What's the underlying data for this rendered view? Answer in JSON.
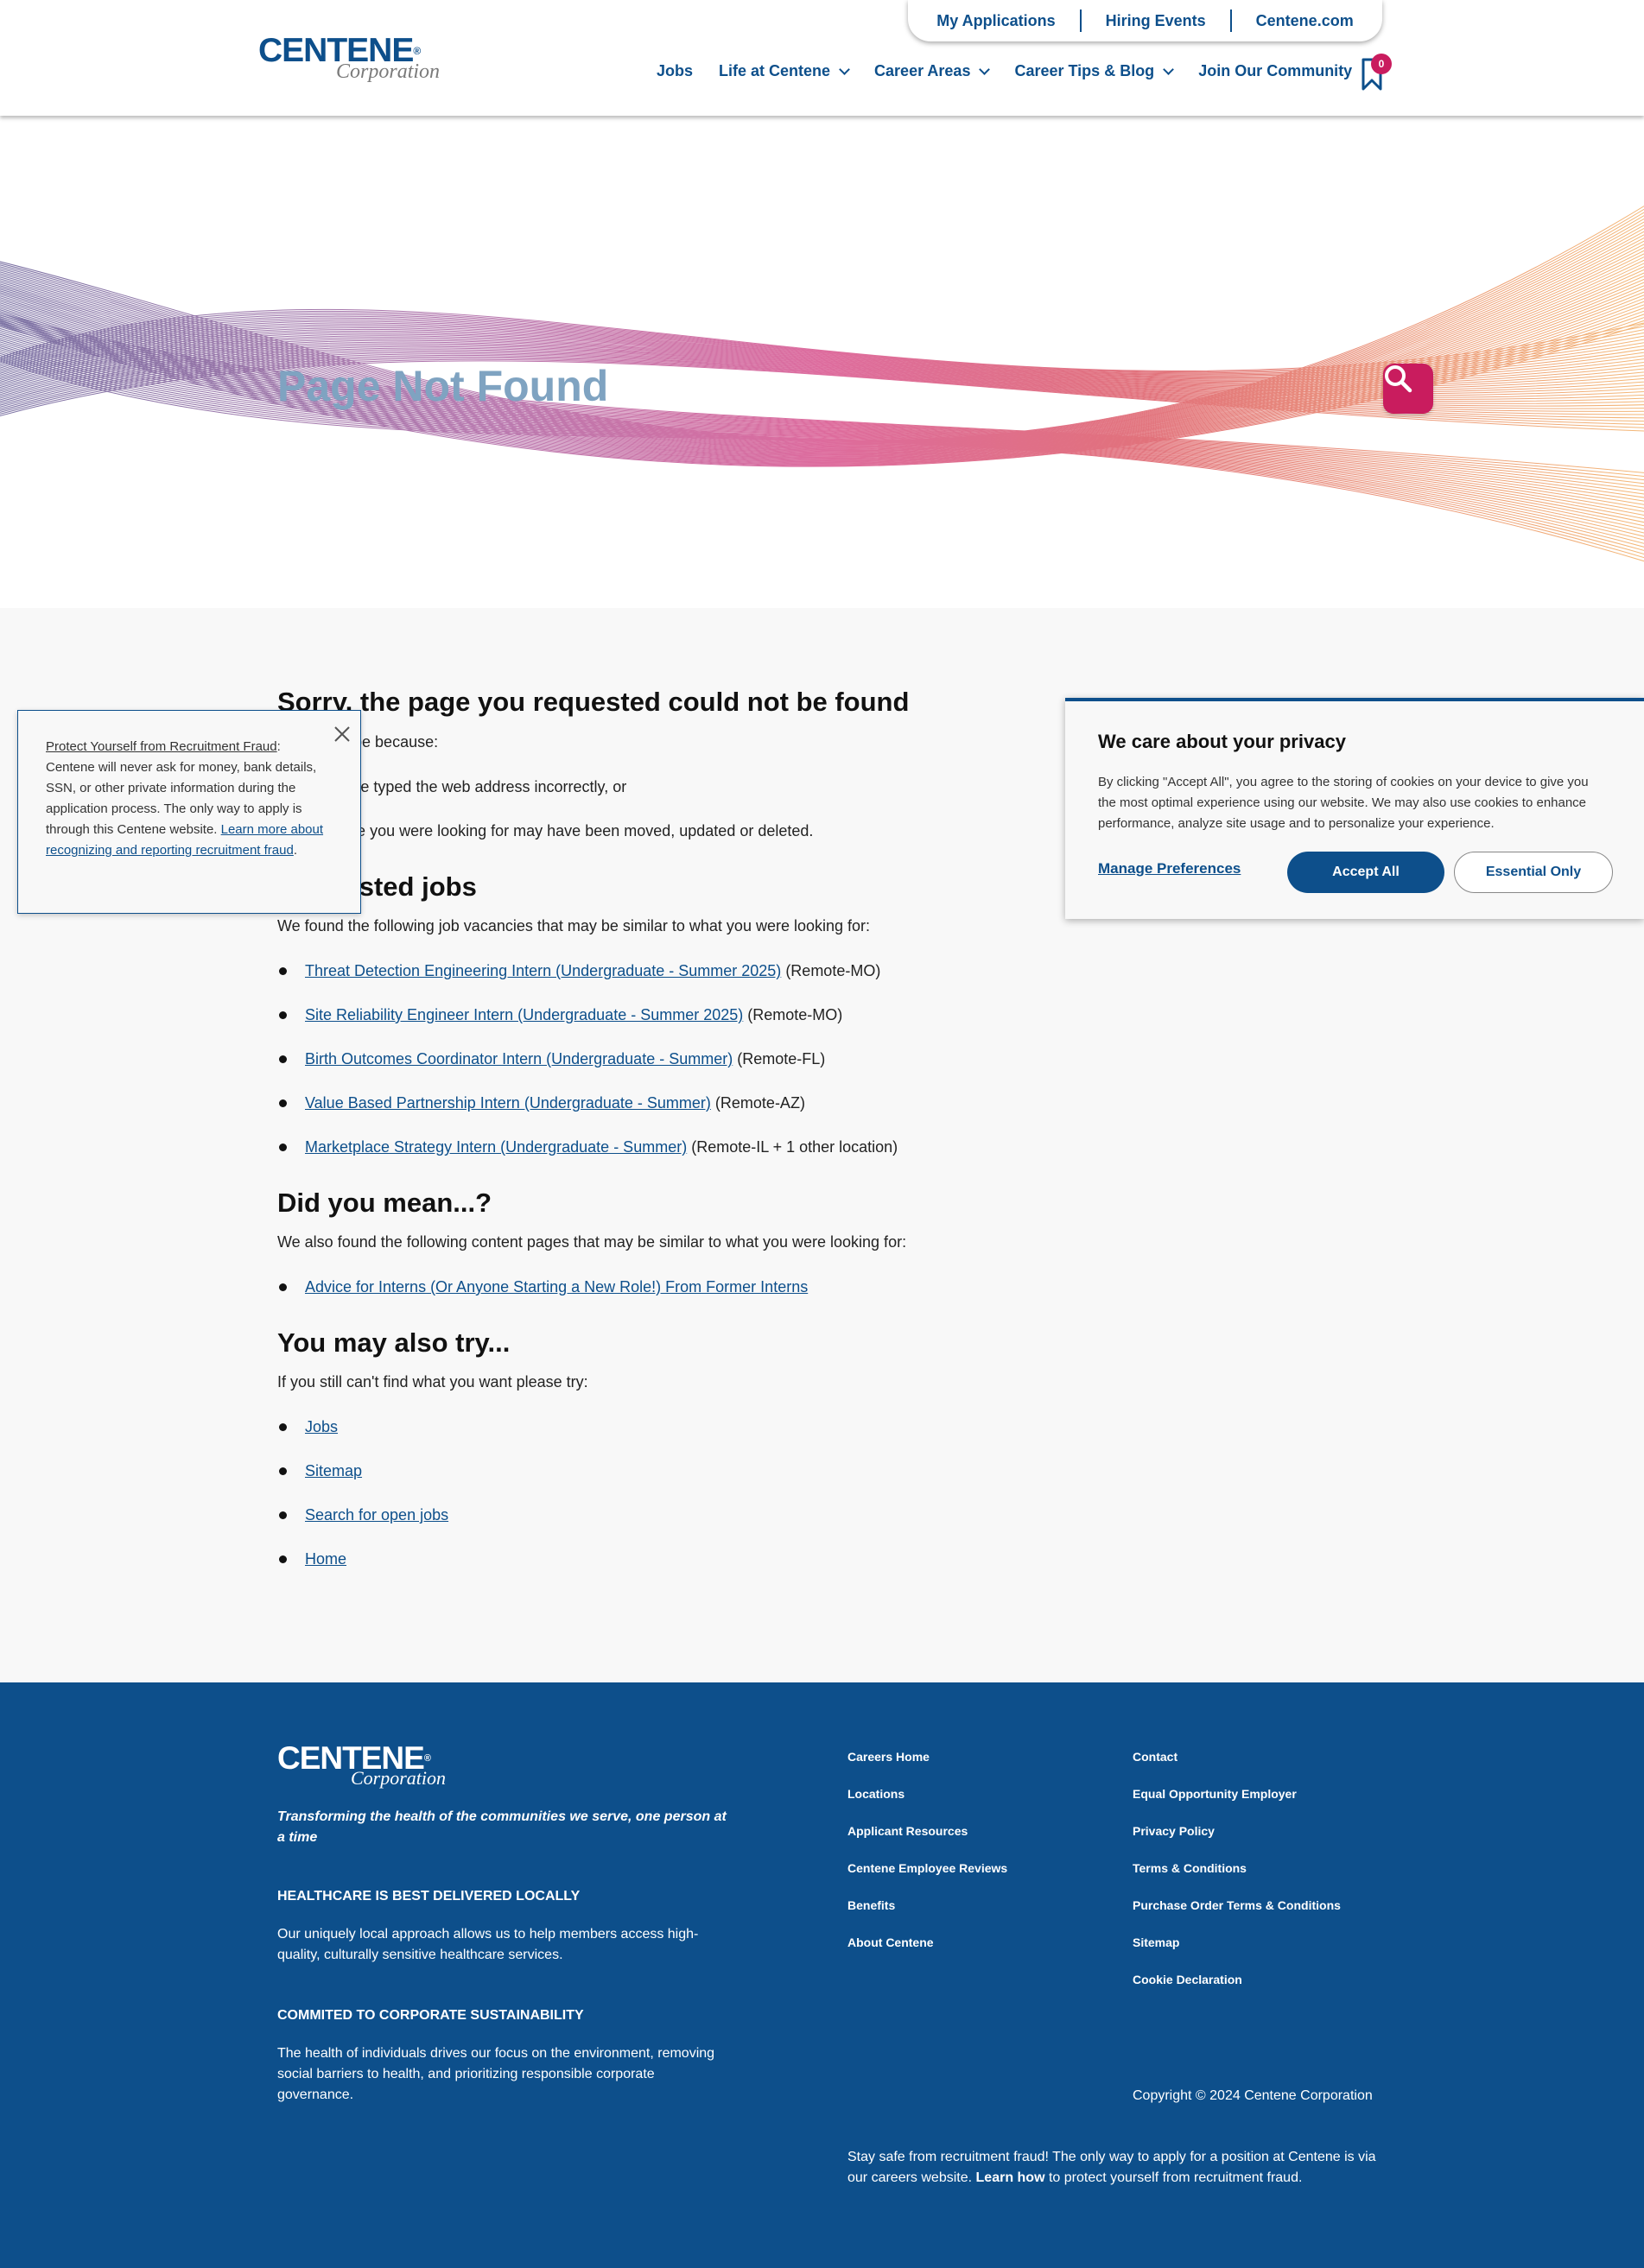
{
  "header": {
    "logo": {
      "brand": "CENTENE",
      "reg": "®",
      "sub": "Corporation"
    },
    "utility_links": [
      "My Applications",
      "Hiring Events",
      "Centene.com"
    ],
    "nav": [
      {
        "label": "Jobs",
        "dropdown": false
      },
      {
        "label": "Life at Centene",
        "dropdown": true
      },
      {
        "label": "Career Areas",
        "dropdown": true
      },
      {
        "label": "Career Tips & Blog",
        "dropdown": true
      },
      {
        "label": "Join Our Community",
        "dropdown": false
      }
    ],
    "saved_jobs_count": "0"
  },
  "hero": {
    "title": "Page Not Found"
  },
  "content": {
    "heading": "Sorry, the page you requested could not be found",
    "reason_intro": "This might be because:",
    "reasons": [
      "You have typed the web address incorrectly, or",
      "the page you were looking for may have been moved, updated or deleted."
    ],
    "suggested_heading": "Suggested jobs",
    "suggested_intro": "We found the following job vacancies that may be similar to what you were looking for:",
    "jobs": [
      {
        "title": "Threat Detection Engineering Intern (Undergraduate - Summer 2025)",
        "location": "(Remote-MO)"
      },
      {
        "title": "Site Reliability Engineer Intern (Undergraduate - Summer 2025)",
        "location": "(Remote-MO)"
      },
      {
        "title": "Birth Outcomes Coordinator Intern (Undergraduate - Summer)",
        "location": "(Remote-FL)"
      },
      {
        "title": "Value Based Partnership Intern (Undergraduate - Summer)",
        "location": "(Remote-AZ)"
      },
      {
        "title": "Marketplace Strategy Intern (Undergraduate - Summer)",
        "location": "(Remote-IL + 1 other location)"
      }
    ],
    "didyoumean_heading": "Did you mean...?",
    "didyoumean_intro": "We also found the following content pages that may be similar to what you were looking for:",
    "pages": [
      "Advice for Interns (Or Anyone Starting a New Role!) From Former Interns"
    ],
    "try_heading": "You may also try...",
    "try_intro": "If you still can't find what you want please try:",
    "try_links": [
      "Jobs",
      "Sitemap",
      "Search for open jobs",
      "Home"
    ]
  },
  "fraud_popup": {
    "title": "Protect Yourself from Recruitment Fraud",
    "text": ": Centene will never ask for money, bank details, SSN, or other private information during the application process. The only way to apply is through this Centene website. ",
    "link": "Learn more about recognizing and reporting recruitment fraud",
    "end": "."
  },
  "cookie_banner": {
    "title": "We care about your privacy",
    "body": "By clicking \"Accept All\", you agree to the storing of cookies on your device to give you the most optimal experience using our website. We may also use cookies to enhance performance, analyze site usage and to personalize your experience.",
    "manage": "Manage Preferences",
    "accept": "Accept All",
    "essential": "Essential Only"
  },
  "footer": {
    "logo": {
      "brand": "CENTENE",
      "reg": "®",
      "sub": "Corporation"
    },
    "tagline": "Transforming the health of the communities we serve, one person at a time",
    "section1_title": "HEALTHCARE IS BEST DELIVERED LOCALLY",
    "section1_text": "Our uniquely local approach allows us to help members access high-quality, culturally sensitive healthcare services.",
    "section2_title": "COMMITED TO CORPORATE SUSTAINABILITY",
    "section2_text": "The health of individuals drives our focus on the environment, removing social barriers to health, and prioritizing responsible corporate governance.",
    "col1": [
      "Careers Home",
      "Locations",
      "Applicant Resources",
      "Centene Employee Reviews",
      "Benefits",
      "About Centene"
    ],
    "col2": [
      "Contact",
      "Equal Opportunity Employer",
      "Privacy Policy",
      "Terms & Conditions",
      "Purchase Order Terms & Conditions",
      "Sitemap",
      "Cookie Declaration"
    ],
    "copyright": "Copyright © 2024 Centene Corporation",
    "fraud_text_1": "Stay safe from recruitment fraud! The only way to apply for a position at Centene is via our careers website. ",
    "fraud_link": "Learn how",
    "fraud_text_2": " to protect yourself from recruitment fraud."
  },
  "colors": {
    "brand_blue": "#0d4f8b",
    "accent_pink": "#c91c5e",
    "title_blue": "#7fa3c1"
  },
  "icons": [
    "chevron-down-icon",
    "bookmark-icon",
    "search-icon",
    "close-icon"
  ]
}
